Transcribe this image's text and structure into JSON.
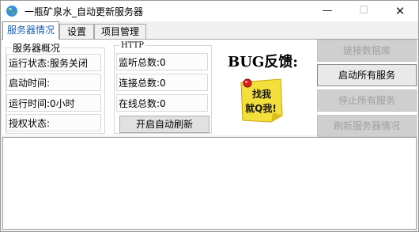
{
  "window": {
    "title": "一瓶矿泉水_自动更新服务器",
    "minimize": "—",
    "maximize": "☐",
    "close": "✕"
  },
  "tabs": [
    {
      "label": "服务器情况",
      "active": true
    },
    {
      "label": "设置",
      "active": false
    },
    {
      "label": "项目管理",
      "active": false
    }
  ],
  "overview": {
    "title": "服务器概况",
    "fields": [
      "运行状态:服务关闭",
      "启动时间:",
      "运行时间:0小时",
      "授权状态:"
    ]
  },
  "http": {
    "title": "HTTP",
    "fields": [
      "监听总数:0",
      "连接总数:0",
      "在线总数:0"
    ],
    "refresh_button": "开启自动刷新"
  },
  "bug": {
    "label": "BUG反馈:",
    "note_text": "找我就Q我!"
  },
  "actions": {
    "connect_db": "链接数据库",
    "start_all": "启动所有服务",
    "stop_all": "停止所有服务",
    "refresh_status": "刷新服务器情况"
  },
  "log": {
    "content": ""
  }
}
